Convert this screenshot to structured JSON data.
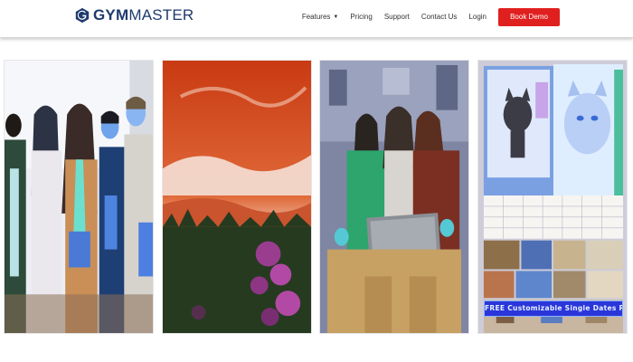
{
  "header": {
    "logo": {
      "brand_bold": "GYM",
      "brand_light": "MASTER"
    },
    "nav": [
      {
        "label": "Features",
        "has_dropdown": true
      },
      {
        "label": "Pricing"
      },
      {
        "label": "Support"
      },
      {
        "label": "Contact Us"
      },
      {
        "label": "Login"
      }
    ],
    "cta_label": "Book Demo",
    "cta_color": "#e0201f",
    "brand_color": "#1f3a6e"
  },
  "gallery": {
    "cards": [
      {
        "name": "students-group"
      },
      {
        "name": "sunset-landscape"
      },
      {
        "name": "friends-laptop"
      },
      {
        "name": "pet-calendar",
        "banner": "FREE Customizable Single Dates Pet Calendar"
      }
    ]
  }
}
